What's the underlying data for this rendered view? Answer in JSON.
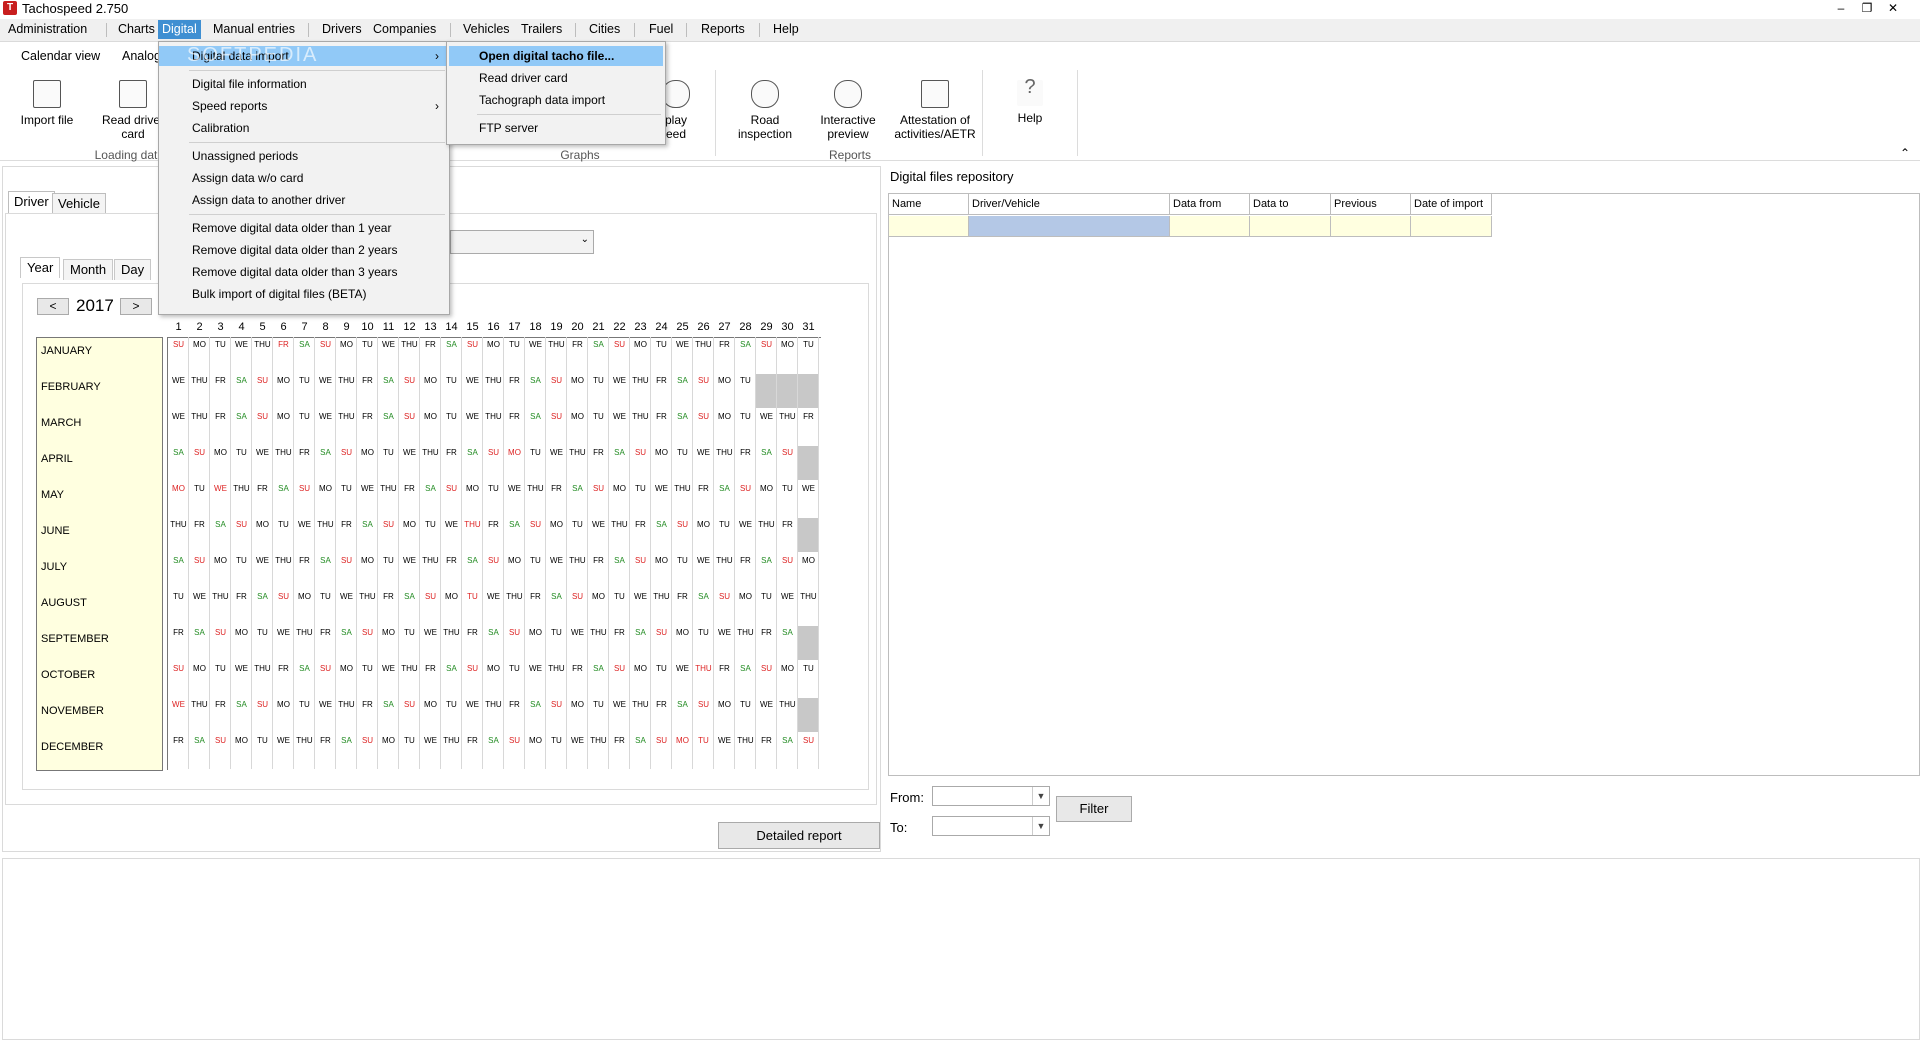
{
  "window": {
    "title": "Tachospeed 2.750",
    "minimize": "–",
    "restore": "❐",
    "close": "✕"
  },
  "menubar": [
    "Administration",
    "Charts",
    "Digital",
    "Manual entries",
    "Drivers",
    "Companies",
    "Vehicles",
    "Trailers",
    "Cities",
    "Fuel",
    "Reports",
    "Help"
  ],
  "ribbon_tabs": [
    "Calendar view",
    "Analog"
  ],
  "ribbon": {
    "import_file": "Import file",
    "read_driver_card": "Read driver card",
    "display_speed": "play eed",
    "road_inspection": "Road inspection",
    "interactive_preview": "Interactive preview",
    "attestation": "Attestation of activities/AETR",
    "help": "Help",
    "group_loading": "Loading dat",
    "group_graphs": "Graphs",
    "group_reports": "Reports",
    "collapse": "⌃"
  },
  "digital_menu": {
    "items": [
      "Digital data import",
      "Digital file information",
      "Speed reports",
      "Calibration",
      "Unassigned periods",
      "Assign data w/o card",
      "Assign data to another driver",
      "Remove digital data older than 1 year",
      "Remove digital data older than 2 years",
      "Remove digital data older than 3 years",
      "Bulk import of digital files (BETA)"
    ],
    "submenu": [
      "Open digital tacho file...",
      "Read driver card",
      "Tachograph data import",
      "FTP server"
    ],
    "watermark": "SOFTPEDIA"
  },
  "left_tabs": [
    "Driver",
    "Vehicle"
  ],
  "period_tabs": [
    "Year",
    "Month",
    "Day"
  ],
  "calendar": {
    "year": "2017",
    "prev": "<",
    "next": ">",
    "months": [
      "JANUARY",
      "FEBRUARY",
      "MARCH",
      "APRIL",
      "MAY",
      "JUNE",
      "JULY",
      "AUGUST",
      "SEPTEMBER",
      "OCTOBER",
      "NOVEMBER",
      "DECEMBER"
    ],
    "days": [
      "1",
      "2",
      "3",
      "4",
      "5",
      "6",
      "7",
      "8",
      "9",
      "10",
      "11",
      "12",
      "13",
      "14",
      "15",
      "16",
      "17",
      "18",
      "19",
      "20",
      "21",
      "22",
      "23",
      "24",
      "25",
      "26",
      "27",
      "28",
      "29",
      "30",
      "31"
    ],
    "first_weekday": [
      6,
      2,
      2,
      5,
      0,
      3,
      5,
      1,
      4,
      6,
      2,
      4
    ],
    "month_lengths": [
      31,
      28,
      31,
      30,
      31,
      30,
      31,
      31,
      30,
      31,
      30,
      31
    ],
    "weekday_labels": [
      "MO",
      "TU",
      "WE",
      "THU",
      "FR",
      "SA",
      "SU"
    ],
    "holidays": [
      [
        0,
        5
      ],
      [
        3,
        16
      ],
      [
        4,
        0
      ],
      [
        4,
        2
      ],
      [
        5,
        14
      ],
      [
        7,
        14
      ],
      [
        9,
        25
      ],
      [
        10,
        0
      ],
      [
        11,
        24
      ],
      [
        11,
        25
      ]
    ]
  },
  "detailed_report": "Detailed report",
  "repository": {
    "title": "Digital files repository",
    "columns": [
      "Name",
      "Driver/Vehicle",
      "Data from",
      "Data to",
      "Previous",
      "Date of import"
    ],
    "from_label": "From:",
    "to_label": "To:",
    "filter": "Filter"
  },
  "colors": {
    "menu_active": "#3f8fd2",
    "menu_highlight": "#91c9f7",
    "weekend": "#228b22",
    "sunday": "#dd2222",
    "cell_yellow": "#ffffe0",
    "selected_cell": "#b4c8e6"
  }
}
